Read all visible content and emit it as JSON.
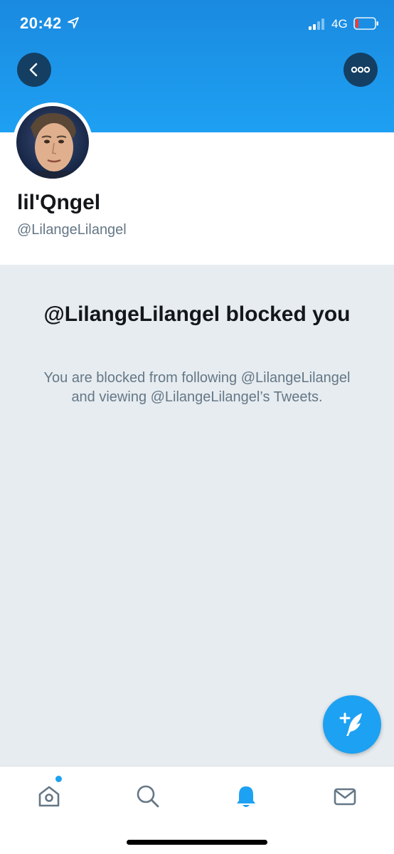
{
  "status_bar": {
    "time": "20:42",
    "network": "4G",
    "location_icon": "location-arrow-icon",
    "signal_icon": "signal-icon",
    "battery_icon": "battery-low-icon"
  },
  "header": {
    "back_icon": "chevron-left-icon",
    "more_icon": "more-horizontal-icon"
  },
  "profile": {
    "display_name": "lil'Qngel",
    "handle": "@LilangeLilangel"
  },
  "blocked": {
    "title": "@LilangeLilangel blocked you",
    "description": "You are blocked from following @LilangeLilangel and viewing @LilangeLilangel’s Tweets."
  },
  "fab": {
    "icon": "compose-tweet-icon"
  },
  "tab_bar": {
    "items": [
      {
        "name": "home",
        "icon": "home-icon",
        "active": false,
        "has_dot": true
      },
      {
        "name": "search",
        "icon": "search-icon",
        "active": false
      },
      {
        "name": "notifications",
        "icon": "bell-icon",
        "active": true
      },
      {
        "name": "messages",
        "icon": "mail-icon",
        "active": false
      }
    ]
  },
  "colors": {
    "accent": "#1da1f2",
    "banner": "#1a8ae0",
    "background": "#e6ecf0",
    "text_primary": "#14171a",
    "text_secondary": "#657786"
  }
}
